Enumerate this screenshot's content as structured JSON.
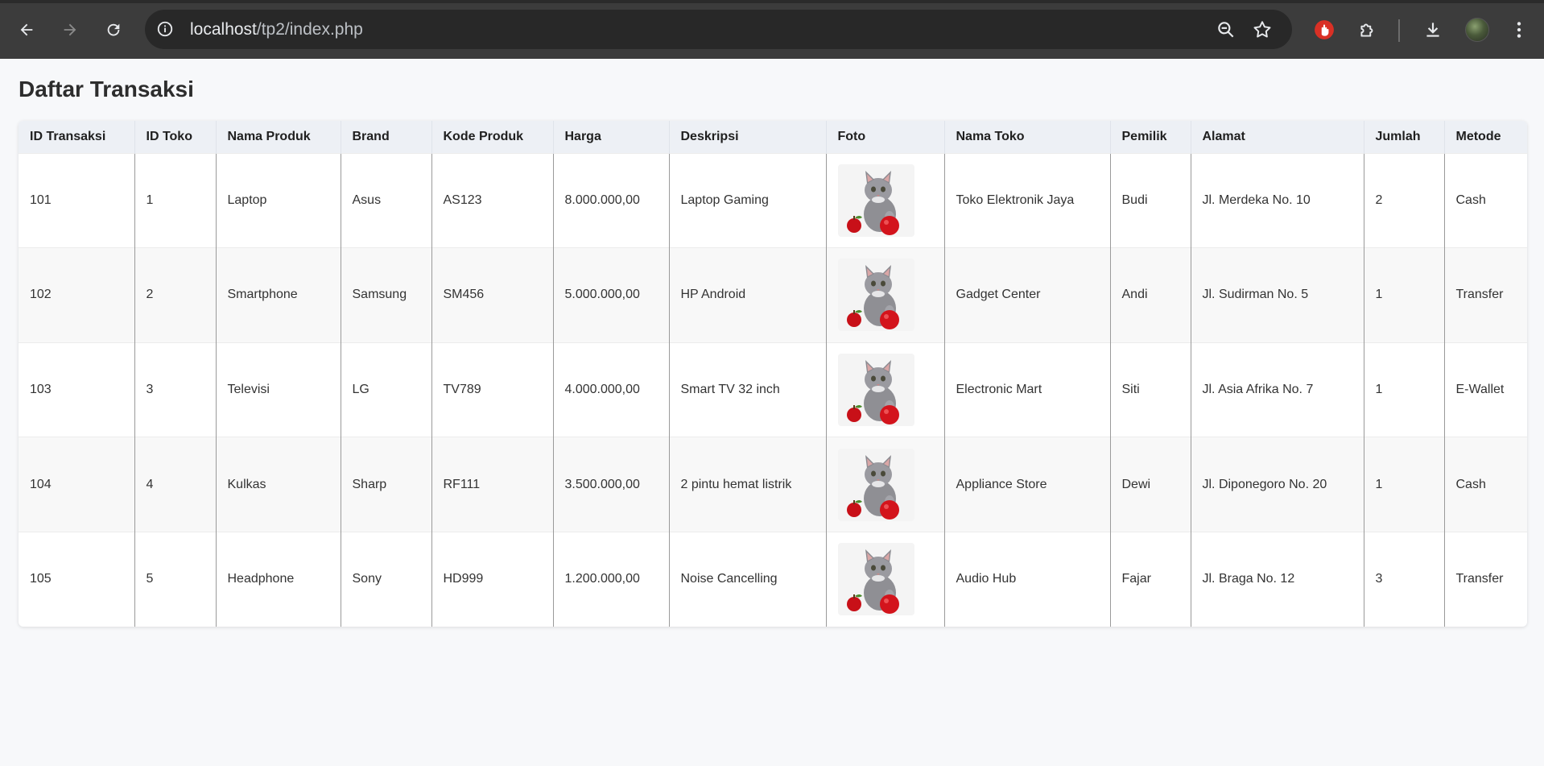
{
  "browser": {
    "url_host": "localhost",
    "url_path": "/tp2/index.php"
  },
  "page": {
    "title": "Daftar Transaksi"
  },
  "table": {
    "headers": [
      "ID Transaksi",
      "ID Toko",
      "Nama Produk",
      "Brand",
      "Kode Produk",
      "Harga",
      "Deskripsi",
      "Foto",
      "Nama Toko",
      "Pemilik",
      "Alamat",
      "Jumlah",
      "Metode"
    ],
    "rows": [
      {
        "id_transaksi": "101",
        "id_toko": "1",
        "nama_produk": "Laptop",
        "brand": "Asus",
        "kode_produk": "AS123",
        "harga": "8.000.000,00",
        "deskripsi": "Laptop Gaming",
        "foto": "cat-with-apple-photo",
        "nama_toko": "Toko Elektronik Jaya",
        "pemilik": "Budi",
        "alamat": "Jl. Merdeka No. 10",
        "jumlah": "2",
        "metode": "Cash"
      },
      {
        "id_transaksi": "102",
        "id_toko": "2",
        "nama_produk": "Smartphone",
        "brand": "Samsung",
        "kode_produk": "SM456",
        "harga": "5.000.000,00",
        "deskripsi": "HP Android",
        "foto": "cat-with-apple-photo",
        "nama_toko": "Gadget Center",
        "pemilik": "Andi",
        "alamat": "Jl. Sudirman No. 5",
        "jumlah": "1",
        "metode": "Transfer"
      },
      {
        "id_transaksi": "103",
        "id_toko": "3",
        "nama_produk": "Televisi",
        "brand": "LG",
        "kode_produk": "TV789",
        "harga": "4.000.000,00",
        "deskripsi": "Smart TV 32 inch",
        "foto": "cat-with-apple-photo",
        "nama_toko": "Electronic Mart",
        "pemilik": "Siti",
        "alamat": "Jl. Asia Afrika No. 7",
        "jumlah": "1",
        "metode": "E-Wallet"
      },
      {
        "id_transaksi": "104",
        "id_toko": "4",
        "nama_produk": "Kulkas",
        "brand": "Sharp",
        "kode_produk": "RF111",
        "harga": "3.500.000,00",
        "deskripsi": "2 pintu hemat listrik",
        "foto": "cat-with-apple-photo",
        "nama_toko": "Appliance Store",
        "pemilik": "Dewi",
        "alamat": "Jl. Diponegoro No. 20",
        "jumlah": "1",
        "metode": "Cash"
      },
      {
        "id_transaksi": "105",
        "id_toko": "5",
        "nama_produk": "Headphone",
        "brand": "Sony",
        "kode_produk": "HD999",
        "harga": "1.200.000,00",
        "deskripsi": "Noise Cancelling",
        "foto": "cat-with-apple-photo",
        "nama_toko": "Audio Hub",
        "pemilik": "Fajar",
        "alamat": "Jl. Braga No. 12",
        "jumlah": "3",
        "metode": "Transfer"
      }
    ]
  },
  "colors": {
    "chrome_bg": "#3c3c3c",
    "omnibox_bg": "#282828",
    "header_row_bg": "#edf0f5",
    "page_bg": "#f7f8fa",
    "extension_red": "#d93025"
  }
}
